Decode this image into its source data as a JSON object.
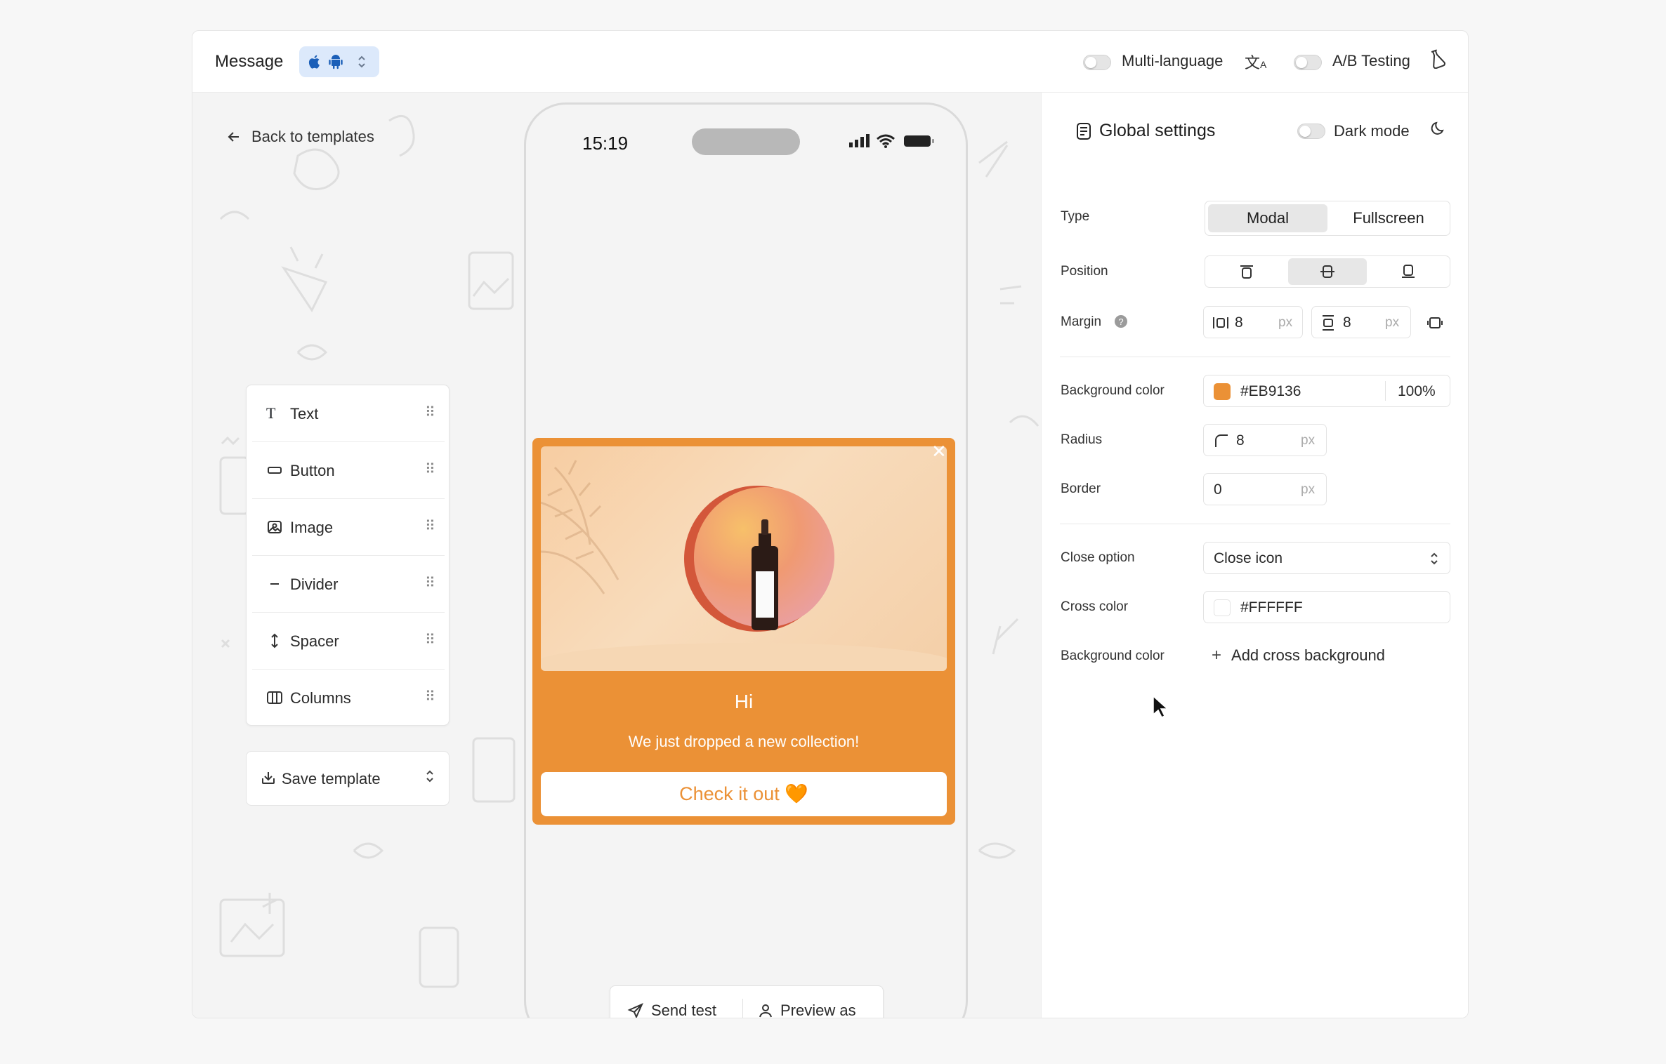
{
  "header": {
    "title": "Message",
    "multi_language": "Multi-language",
    "ab_testing": "A/B Testing"
  },
  "canvas": {
    "back_label": "Back to templates",
    "blocks": [
      {
        "label": "Text",
        "icon": "text-icon"
      },
      {
        "label": "Button",
        "icon": "button-icon"
      },
      {
        "label": "Image",
        "icon": "image-icon"
      },
      {
        "label": "Divider",
        "icon": "divider-icon"
      },
      {
        "label": "Spacer",
        "icon": "spacer-icon"
      },
      {
        "label": "Columns",
        "icon": "columns-icon"
      }
    ],
    "save_template": "Save template"
  },
  "phone": {
    "time": "15:19",
    "modal": {
      "title": "Hi",
      "subtitle": "We just dropped a new collection!",
      "button": "Check it out 🧡",
      "background": "#EB9136"
    }
  },
  "actions": {
    "send_test": "Send test",
    "preview_as": "Preview as"
  },
  "settings": {
    "title": "Global settings",
    "dark_mode": "Dark mode",
    "type_label": "Type",
    "type_options": [
      "Modal",
      "Fullscreen"
    ],
    "type_selected": "Modal",
    "position_label": "Position",
    "margin_label": "Margin",
    "margin_h": "8",
    "margin_v": "8",
    "unit": "px",
    "bg_color_label": "Background color",
    "bg_color": "#EB9136",
    "bg_opacity": "100%",
    "radius_label": "Radius",
    "radius": "8",
    "border_label": "Border",
    "border": "0",
    "close_option_label": "Close option",
    "close_option": "Close icon",
    "cross_color_label": "Cross color",
    "cross_color": "#FFFFFF",
    "cross_bg_label": "Background color",
    "add_cross_bg": "Add cross background"
  }
}
